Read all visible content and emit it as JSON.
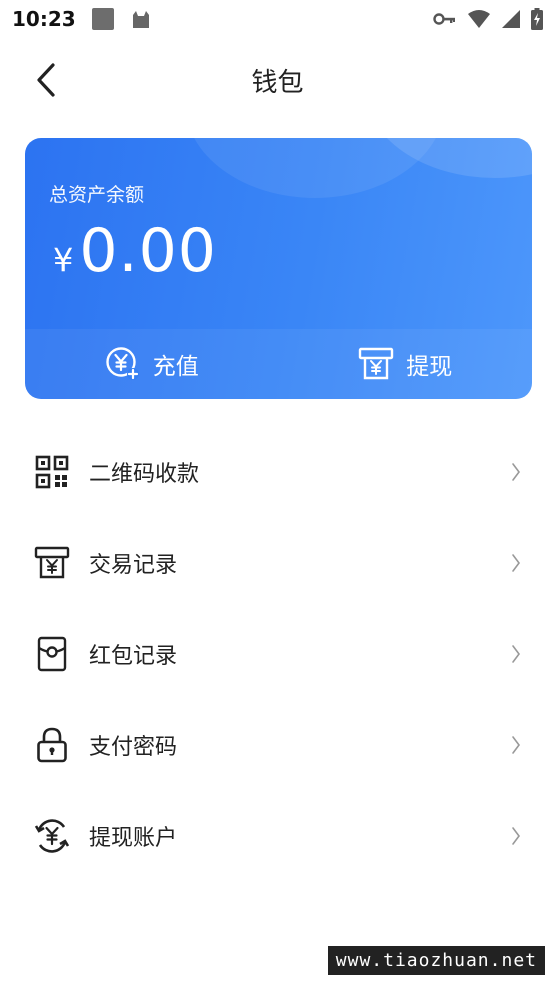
{
  "status_bar": {
    "time": "10:23"
  },
  "header": {
    "title": "钱包"
  },
  "card": {
    "label": "总资产余额",
    "currency": "¥",
    "amount": "0.00",
    "actions": [
      {
        "label": "充值",
        "icon": "recharge-icon"
      },
      {
        "label": "提现",
        "icon": "withdraw-icon"
      }
    ],
    "colors": {
      "gradient_start": "#2c73f1",
      "gradient_end": "#4d97fb"
    }
  },
  "menu": {
    "items": [
      {
        "label": "二维码收款",
        "icon": "qr-code-icon"
      },
      {
        "label": "交易记录",
        "icon": "transaction-record-icon"
      },
      {
        "label": "红包记录",
        "icon": "red-packet-icon"
      },
      {
        "label": "支付密码",
        "icon": "lock-icon"
      },
      {
        "label": "提现账户",
        "icon": "withdraw-account-icon"
      }
    ]
  },
  "watermark": {
    "text": "www.tiaozhuan.net"
  }
}
